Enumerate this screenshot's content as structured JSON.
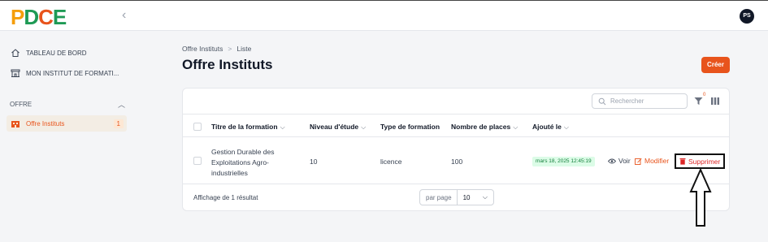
{
  "brand": {
    "logo_p": "P",
    "logo_d": "D",
    "logo_c": "C",
    "logo_e": "E"
  },
  "user": {
    "initials": "PS"
  },
  "sidebar": {
    "items": [
      {
        "label": "TABLEAU DE BORD",
        "icon": "home-icon"
      },
      {
        "label": "MON INSTITUT DE FORMATI...",
        "icon": "building-icon"
      }
    ],
    "section": {
      "label": "OFFRE"
    },
    "active_item": {
      "label": "Offre Instituts",
      "count": "1",
      "icon": "institution-icon"
    }
  },
  "breadcrumb": {
    "root": "Offre Instituts",
    "separator": ">",
    "current": "Liste"
  },
  "page": {
    "title": "Offre Instituts",
    "create_label": "Créer"
  },
  "toolbar": {
    "search_placeholder": "Rechercher",
    "filter_count": "0"
  },
  "table": {
    "headers": {
      "title": "Titre de la formation",
      "level": "Niveau d'étude",
      "type": "Type de formation",
      "places": "Nombre de places",
      "added": "Ajouté le"
    },
    "rows": [
      {
        "title_line1": "Gestion Durable des",
        "title_line2": "Exploitations Agro-",
        "title_line3": "industrielles",
        "level": "10",
        "type": "licence",
        "places": "100",
        "added": "mars 18, 2025 12:45:19",
        "view_label": "Voir",
        "edit_label": "Modifier",
        "delete_label": "Supprimer"
      }
    ]
  },
  "footer": {
    "summary": "Affichage de 1 résultat",
    "per_page_label": "par page",
    "per_page_value": "10"
  },
  "colors": {
    "accent": "#e8541c",
    "brand_green": "#1e9a55",
    "danger": "#dc2626"
  }
}
